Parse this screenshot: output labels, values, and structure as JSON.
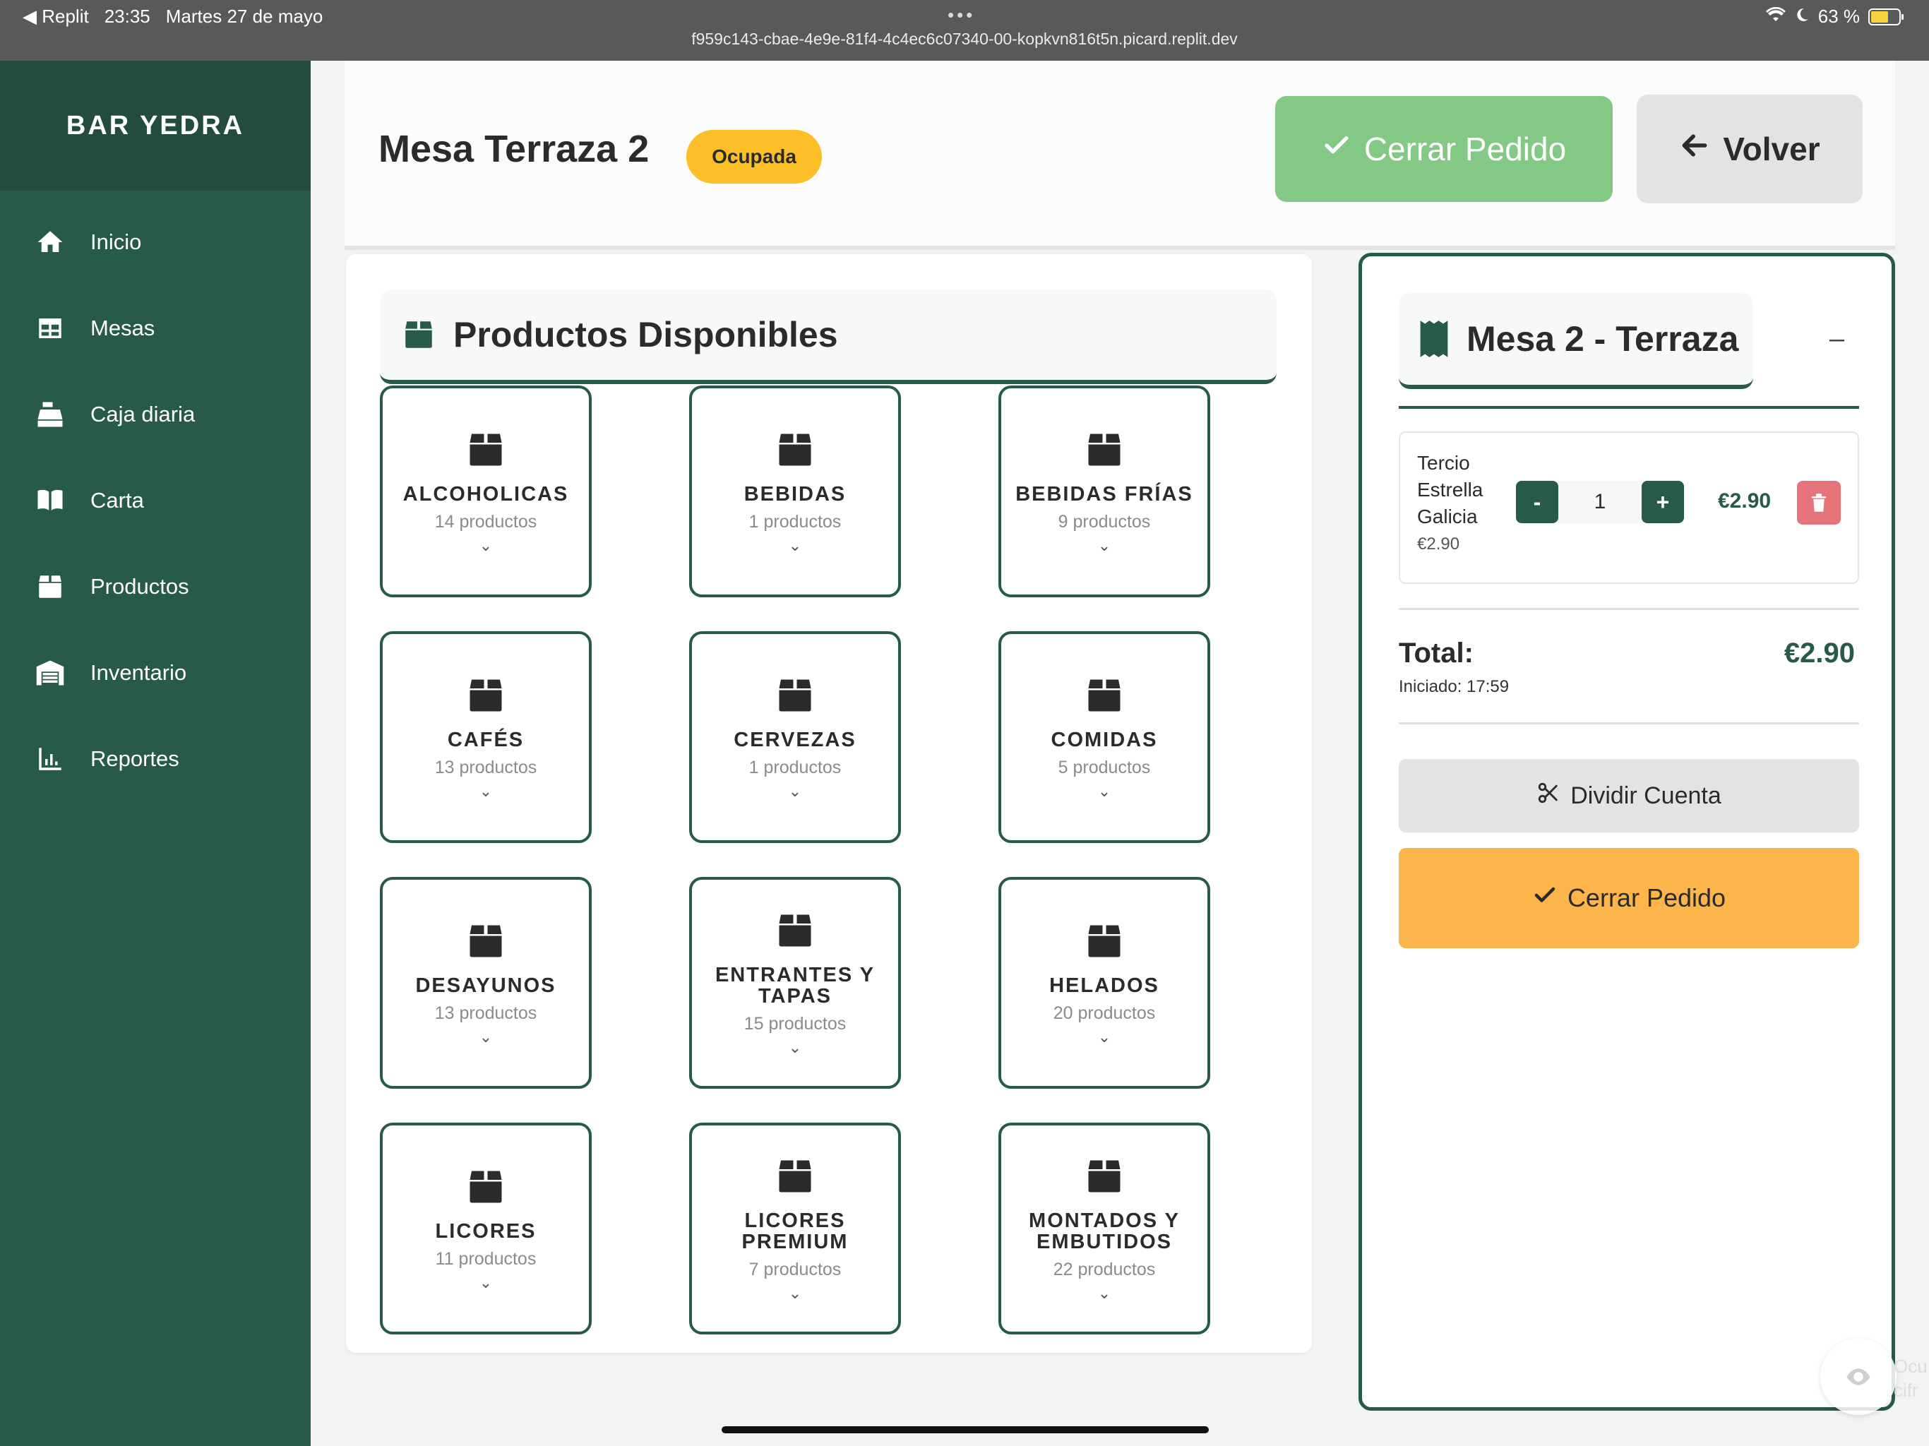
{
  "status_bar": {
    "back_label": "◀ Replit",
    "time": "23:35",
    "date": "Martes 27 de mayo",
    "dots": "•••",
    "url": "f959c143-cbae-4e9e-81f4-4c4ec6c07340-00-kopkvn816t5n.picard.replit.dev",
    "battery": "63 %",
    "battery_color": "#f7d23c"
  },
  "sidebar": {
    "brand": "BAR YEDRA",
    "items": [
      {
        "label": "Inicio",
        "icon": "home-icon"
      },
      {
        "label": "Mesas",
        "icon": "table-icon"
      },
      {
        "label": "Caja diaria",
        "icon": "cash-register-icon"
      },
      {
        "label": "Carta",
        "icon": "book-icon"
      },
      {
        "label": "Productos",
        "icon": "box-icon"
      },
      {
        "label": "Inventario",
        "icon": "warehouse-icon"
      },
      {
        "label": "Reportes",
        "icon": "chart-icon"
      }
    ]
  },
  "header": {
    "title": "Mesa Terraza 2",
    "status_badge": "Ocupada",
    "close_order": "Cerrar Pedido",
    "back": "Volver"
  },
  "products": {
    "title": "Productos Disponibles",
    "categories": [
      {
        "name": "ALCOHOLICAS",
        "count": "14 productos"
      },
      {
        "name": "BEBIDAS",
        "count": "1 productos"
      },
      {
        "name": "BEBIDAS FRÍAS",
        "count": "9 productos"
      },
      {
        "name": "CAFÉS",
        "count": "13 productos"
      },
      {
        "name": "CERVEZAS",
        "count": "1 productos"
      },
      {
        "name": "COMIDAS",
        "count": "5 productos"
      },
      {
        "name": "DESAYUNOS",
        "count": "13 productos"
      },
      {
        "name": "ENTRANTES Y TAPAS",
        "count": "15 productos"
      },
      {
        "name": "HELADOS",
        "count": "20 productos"
      },
      {
        "name": "LICORES",
        "count": "11 productos"
      },
      {
        "name": "LICORES PREMIUM",
        "count": "7 productos"
      },
      {
        "name": "MONTADOS Y EMBUTIDOS",
        "count": "22 productos"
      }
    ]
  },
  "order": {
    "title": "Mesa 2 - Terraza",
    "minimize": "–",
    "items": [
      {
        "name": "Tercio Estrella Galicia",
        "unit_price": "€2.90",
        "qty": "1",
        "total": "€2.90",
        "minus": "-",
        "plus": "+"
      }
    ],
    "total_label": "Total:",
    "total_value": "€2.90",
    "started": "Iniciado: 17:59",
    "split": "Dividir Cuenta",
    "close_order": "Cerrar Pedido"
  },
  "floating": {
    "text_line1": "Ocu",
    "text_line2": "cifr"
  },
  "colors": {
    "primary": "#275a48",
    "badge": "#fcbf28",
    "close_top": "#83c985",
    "close_bottom": "#fcb54a",
    "delete": "#e5737a"
  }
}
